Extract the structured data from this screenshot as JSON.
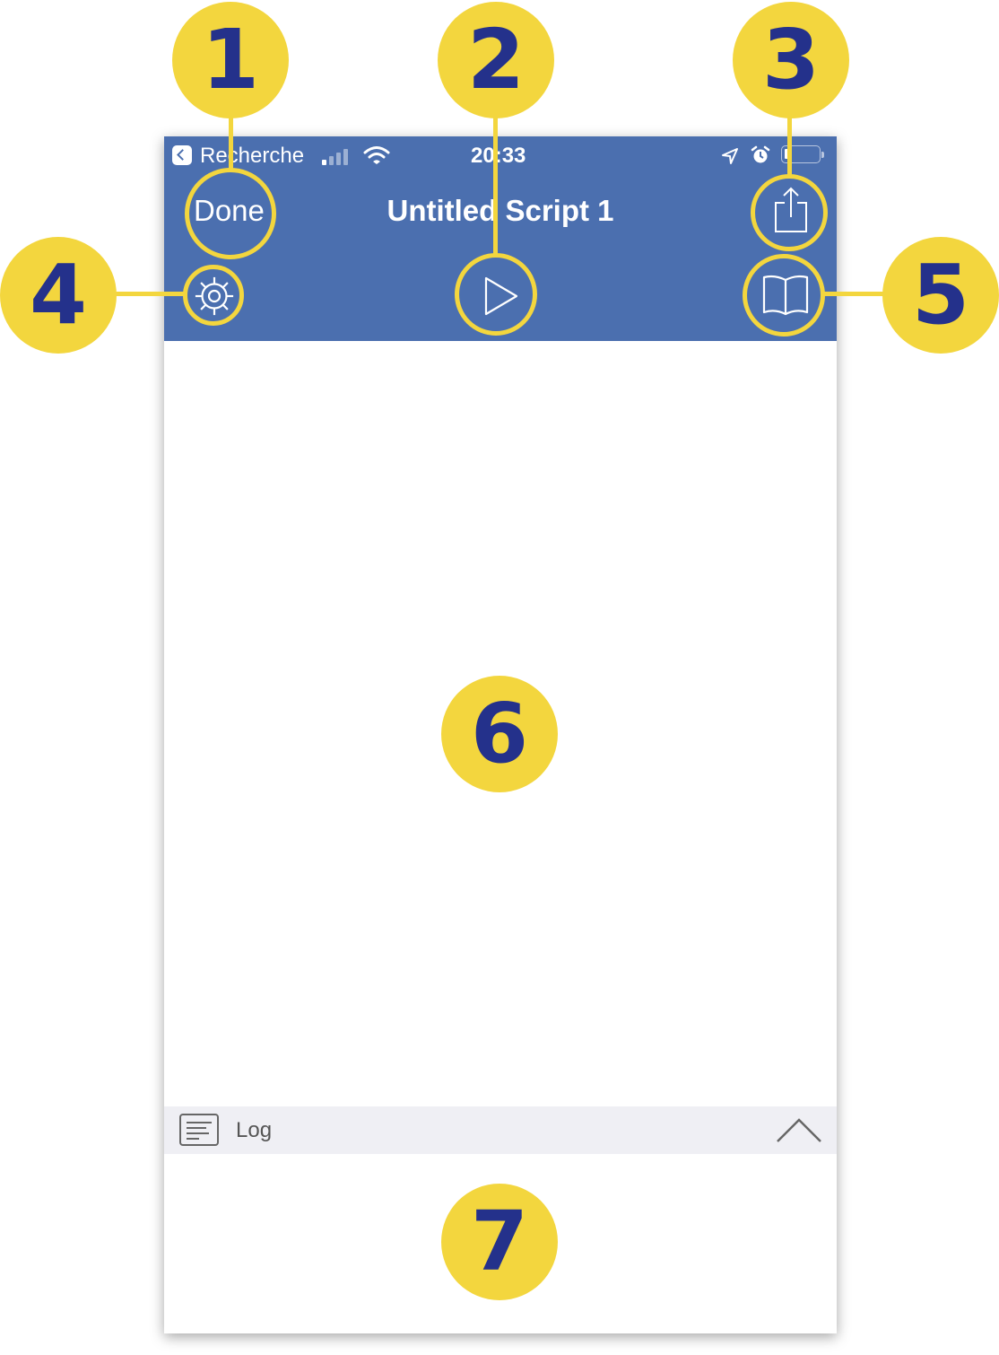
{
  "status_bar": {
    "back_app": "Recherche",
    "time": "20:33",
    "icons": [
      "back-app-icon",
      "signal-icon",
      "wifi-icon",
      "location-icon",
      "alarm-icon",
      "battery-icon"
    ]
  },
  "nav_bar": {
    "done_label": "Done",
    "title": "Untitled Script 1",
    "icons": [
      "share-icon",
      "gear-icon",
      "play-icon",
      "book-icon"
    ]
  },
  "log_bar": {
    "label": "Log",
    "icons": [
      "log-icon",
      "chevron-up-icon"
    ]
  },
  "callouts": [
    "1",
    "2",
    "3",
    "4",
    "5",
    "6",
    "7"
  ],
  "colors": {
    "nav_background": "#4b6faf",
    "callout_yellow": "#f3d63e",
    "callout_text": "#24318b",
    "log_bar_background": "#efeff4"
  }
}
